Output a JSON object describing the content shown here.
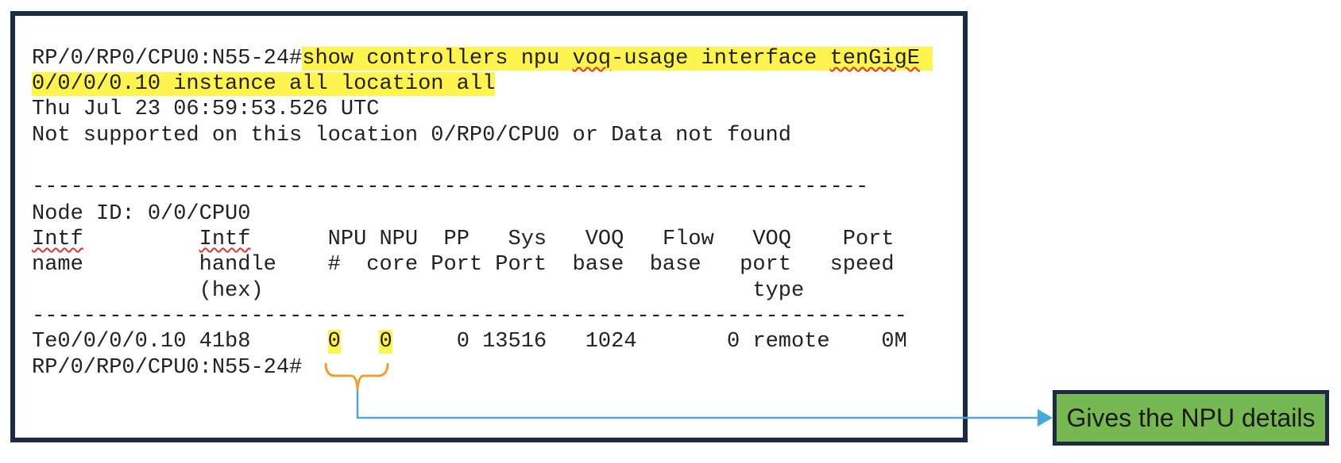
{
  "terminal": {
    "command_prompt": "RP/0/RP0/CPU0:N55-24#",
    "command_part1": "show controllers npu ",
    "command_voq": "voq",
    "command_part2": "-usage interface ",
    "command_tengige": "tenGigE",
    "command_line2": "0/0/0/0.10 instance all location all",
    "timestamp": "Thu Jul 23 06:59:53.526 UTC",
    "not_supported": "Not supported on this location 0/RP0/CPU0 or Data not found",
    "separator1": "-----------------------------------------------------------------",
    "node_id": "Node ID: 0/0/CPU0",
    "header_row1": {
      "intf_a": "Intf",
      "intf_b": "Intf",
      "rest": "      NPU NPU  PP   Sys   VOQ   Flow   VOQ    Port"
    },
    "header_row2": "name         handle    #  core Port Port  base  base   port   speed",
    "header_row3": "             (hex)                                      type",
    "separator2": "--------------------------------------------------------------------",
    "row": {
      "intf_name": "Te0/0/0/0.10",
      "handle": "41b8",
      "npu": "0",
      "core": "0",
      "pp_port": "0",
      "sys_port": "13516",
      "voq_base": "1024",
      "flow_base": "0",
      "port_type": "remote",
      "speed": "0M"
    },
    "final_prompt": "RP/0/RP0/CPU0:N55-24#"
  },
  "callout": {
    "label": "Gives the NPU details"
  },
  "colors": {
    "highlight": "#fff44f",
    "frame": "#1c2a44",
    "callout_bg": "#76b852",
    "bracket": "#f0a030",
    "arrow": "#4aa8d8"
  }
}
